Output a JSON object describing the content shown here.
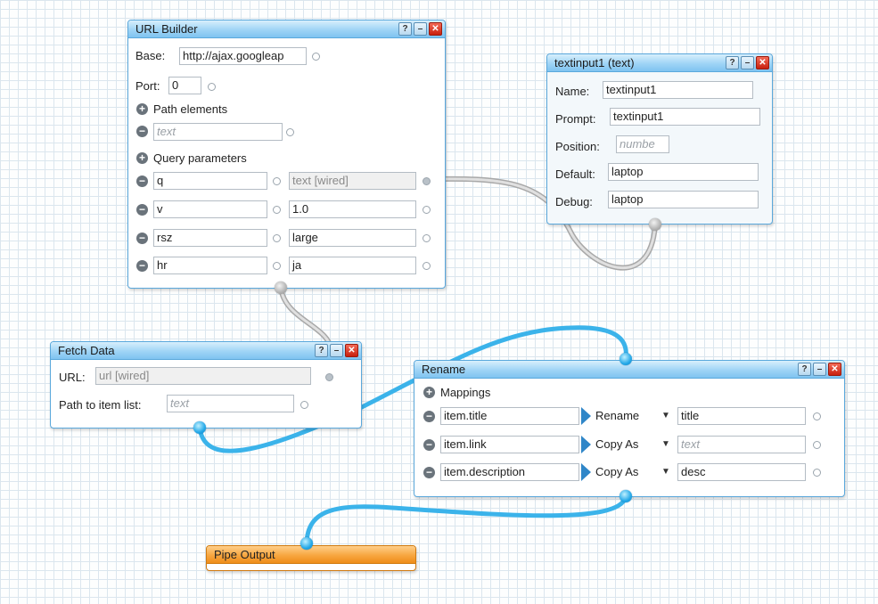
{
  "url_builder": {
    "title": "URL Builder",
    "base_label": "Base:",
    "base_value": "http://ajax.googleap",
    "port_label": "Port:",
    "port_value": "0",
    "path_elements_label": "Path elements",
    "path_placeholder": "text",
    "query_parameters_label": "Query parameters",
    "params": [
      {
        "key": "q",
        "value": "text [wired]"
      },
      {
        "key": "v",
        "value": "1.0"
      },
      {
        "key": "rsz",
        "value": "large"
      },
      {
        "key": "hr",
        "value": "ja"
      }
    ]
  },
  "textinput": {
    "title": "textinput1 (text)",
    "name_label": "Name:",
    "name_value": "textinput1",
    "prompt_label": "Prompt:",
    "prompt_value": "textinput1",
    "position_label": "Position:",
    "position_placeholder": "numbe",
    "default_label": "Default:",
    "default_value": "laptop",
    "debug_label": "Debug:",
    "debug_value": "laptop"
  },
  "fetch_data": {
    "title": "Fetch Data",
    "url_label": "URL:",
    "url_value": "url [wired]",
    "path_label": "Path to item list:",
    "path_placeholder": "text"
  },
  "rename": {
    "title": "Rename",
    "mappings_label": "Mappings",
    "rows": [
      {
        "field": "item.title",
        "op": "Rename",
        "target": "title",
        "target_placeholder": false
      },
      {
        "field": "item.link",
        "op": "Copy As",
        "target": "text",
        "target_placeholder": true
      },
      {
        "field": "item.description",
        "op": "Copy As",
        "target": "desc",
        "target_placeholder": false
      }
    ]
  },
  "pipe_output": {
    "title": "Pipe Output"
  },
  "window_buttons": {
    "help": "?",
    "minimize": "–",
    "close": "✕"
  },
  "colors": {
    "wire_active": "#3bb3ea",
    "wire_inactive": "#c4c4c4",
    "title_blue": "#9fd4f6",
    "title_orange": "#f7a640"
  }
}
